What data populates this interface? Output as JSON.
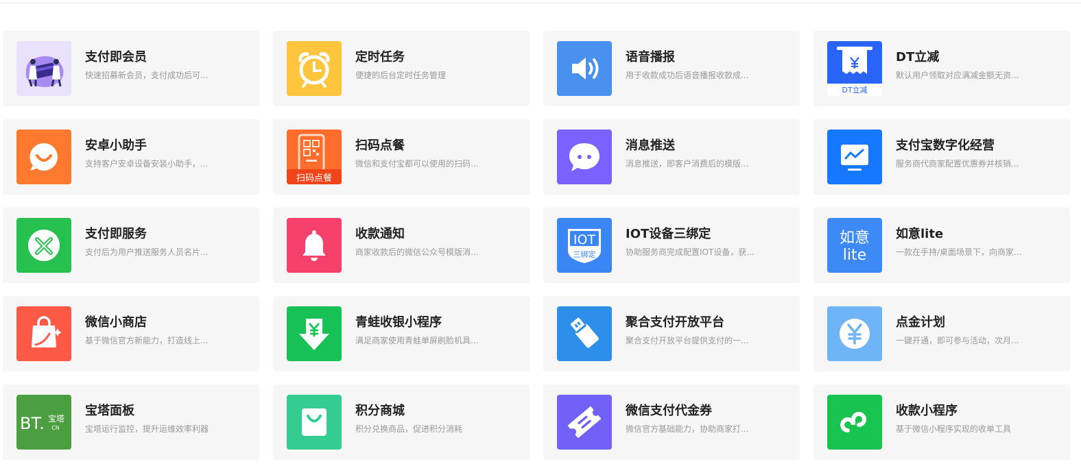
{
  "cards": [
    {
      "title": "支付即会员",
      "desc": "快速招募新会员，支付成功后可...",
      "icon": "membership-illustration-icon",
      "color": "#e9e1ff"
    },
    {
      "title": "定时任务",
      "desc": "便捷的后台定时任务管理",
      "icon": "alarm-clock-icon",
      "color": "#ffc53d"
    },
    {
      "title": "语音播报",
      "desc": "用于收款成功后语音播报收款成...",
      "icon": "speaker-icon",
      "color": "#4a90ee"
    },
    {
      "title": "DT立减",
      "desc": "默认用户领取对应满减金额无资...",
      "icon": "receipt-yuan-icon",
      "color": "#2a64f6",
      "icon_label": "DT立减"
    },
    {
      "title": "安卓小助手",
      "desc": "支持客户安卓设备安装小助手，...",
      "icon": "smile-chat-icon",
      "color": "#ff7a2e"
    },
    {
      "title": "扫码点餐",
      "desc": "微信和支付宝都可以使用的扫码...",
      "icon": "phone-qrcode-icon",
      "color": "#ff6d2c",
      "icon_label": "扫码点餐"
    },
    {
      "title": "消息推送",
      "desc": "消息推送，即客户消费后的模版...",
      "icon": "chat-bubble-icon",
      "color": "#7b61ff"
    },
    {
      "title": "支付宝数字化经营",
      "desc": "服务商代商家配置优惠券并核销...",
      "icon": "monitor-chart-icon",
      "color": "#1677ff"
    },
    {
      "title": "支付即服务",
      "desc": "支付后为用户推送服务人员名片...",
      "icon": "service-link-icon",
      "color": "#27c150"
    },
    {
      "title": "收款通知",
      "desc": "商家收款后的微信公众号模版消...",
      "icon": "bell-icon",
      "color": "#f5406c"
    },
    {
      "title": "IOT设备三绑定",
      "desc": "协助服务商完成配置IOT设备，获...",
      "icon": "iot-badge-icon",
      "color": "#3b86f5",
      "icon_label": "IOT",
      "icon_sublabel": "三绑定"
    },
    {
      "title": "如意lite",
      "desc": "一款在手持/桌面场景下，向商家...",
      "icon": "ruyi-text-icon",
      "color": "#3d8af7",
      "icon_label": "如意",
      "icon_sublabel": "lite"
    },
    {
      "title": "微信小商店",
      "desc": "基于微信官方新能力，打造线上...",
      "icon": "shopping-bag-icon",
      "color": "#fc5a47"
    },
    {
      "title": "青蛙收银小程序",
      "desc": "满足商家使用青蛙单屏刷脸机具...",
      "icon": "yuan-download-icon",
      "color": "#18c155"
    },
    {
      "title": "聚合支付开放平台",
      "desc": "聚合支付开放平台提供支付的一...",
      "icon": "usb-plug-icon",
      "color": "#2d8fe9"
    },
    {
      "title": "点金计划",
      "desc": "一键开通，即可参与活动，次月...",
      "icon": "yuan-coin-icon",
      "color": "#6eb4f6"
    },
    {
      "title": "宝塔面板",
      "desc": "宝塔运行监控，提升运维效率利器",
      "icon": "bt-logo-icon",
      "color": "#4c9f40",
      "icon_label": "BT.",
      "icon_sublabel": "宝塔",
      "icon_sublabel2": "CN"
    },
    {
      "title": "积分商城",
      "desc": "积分兑换商品，促进积分消耗",
      "icon": "gift-bag-icon",
      "color": "#34cd91"
    },
    {
      "title": "微信支付代金券",
      "desc": "微信官方基础能力，协助商家打...",
      "icon": "coupon-ticket-icon",
      "color": "#7261f6"
    },
    {
      "title": "收款小程序",
      "desc": "基于微信小程序实现的收单工具",
      "icon": "mini-program-icon",
      "color": "#18c34f"
    }
  ]
}
